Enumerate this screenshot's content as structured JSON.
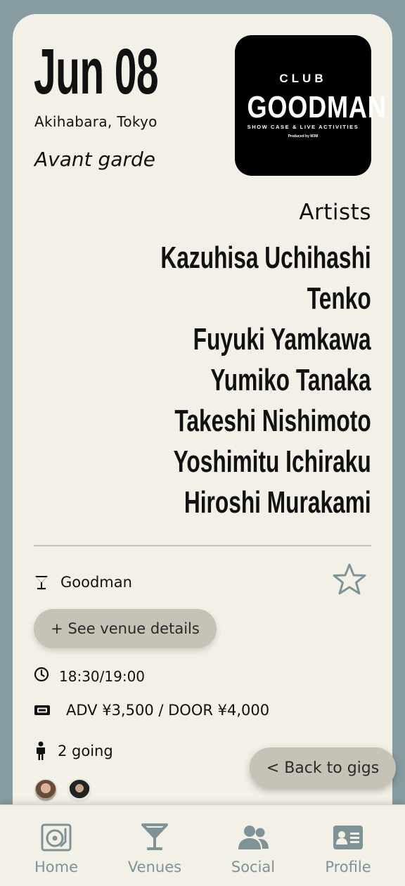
{
  "event": {
    "date": "Jun 08",
    "location": "Akihabara, Tokyo",
    "genre": "Avant garde"
  },
  "logo": {
    "line1": "CLUB",
    "line2": "GOODMAN",
    "tagline": "SHOW CASE & LIVE ACTIVITIES",
    "produced": "Produced by M3M"
  },
  "artists": {
    "title": "Artists",
    "names": [
      "Kazuhisa Uchihashi",
      "Tenko",
      "Fuyuki Yamkawa",
      "Yumiko Tanaka",
      "Takeshi Nishimoto",
      "Yoshimitu Ichiraku",
      "Hiroshi Murakami"
    ]
  },
  "details": {
    "venue": "Goodman",
    "venue_button": "+ See venue details",
    "time": "18:30/19:00",
    "price": "ADV ¥3,500 / DOOR ¥4,000",
    "going": "2 going"
  },
  "back_button": "< Back to gigs",
  "nav": {
    "items": [
      {
        "label": "Home",
        "icon": "turntable-icon"
      },
      {
        "label": "Venues",
        "icon": "cocktail-icon"
      },
      {
        "label": "Social",
        "icon": "users-icon"
      },
      {
        "label": "Profile",
        "icon": "id-card-icon"
      }
    ]
  },
  "colors": {
    "background": "#879ca0",
    "card": "#f3f0e7",
    "button": "#c6c2b6",
    "nav_icon": "#7f9397"
  }
}
